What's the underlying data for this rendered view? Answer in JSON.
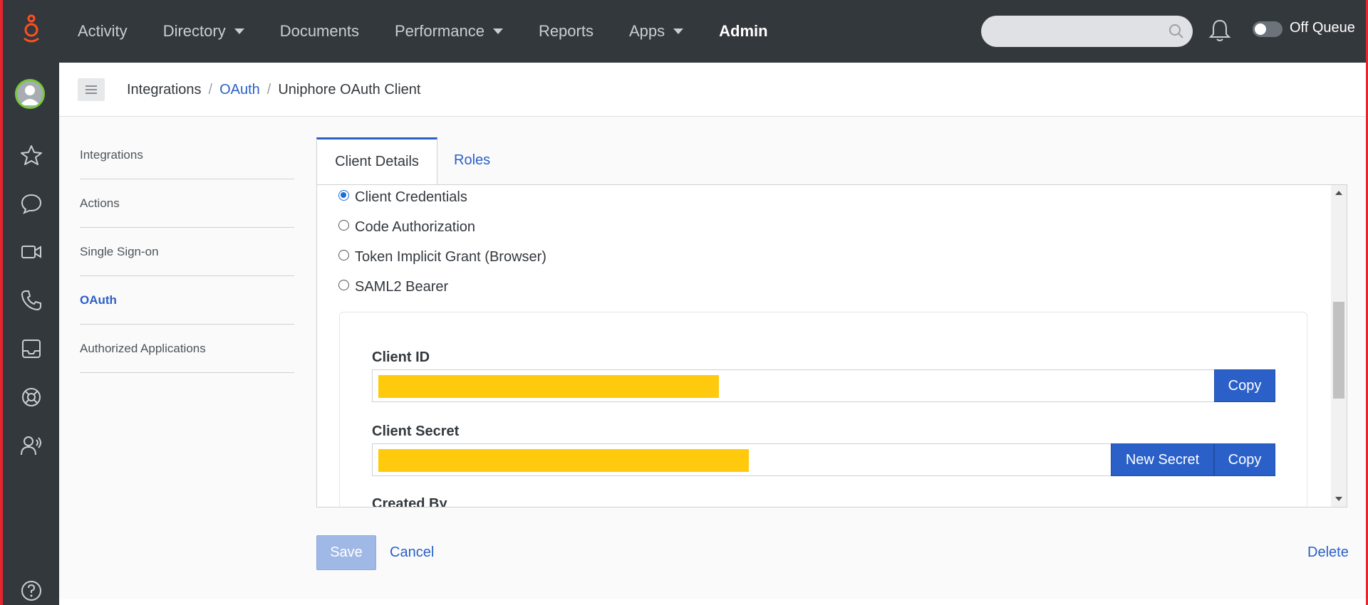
{
  "topnav": {
    "items": [
      {
        "label": "Activity",
        "dropdown": false
      },
      {
        "label": "Directory",
        "dropdown": true
      },
      {
        "label": "Documents",
        "dropdown": false
      },
      {
        "label": "Performance",
        "dropdown": true
      },
      {
        "label": "Reports",
        "dropdown": false
      },
      {
        "label": "Apps",
        "dropdown": true
      }
    ],
    "active_label": "Admin",
    "search_placeholder": "",
    "queue_label": "Off Queue"
  },
  "sidebar_icons": [
    "avatar",
    "star-icon",
    "chat-icon",
    "video-icon",
    "phone-icon",
    "inbox-icon",
    "lifebuoy-icon",
    "contacts-icon",
    "help-icon"
  ],
  "breadcrumb": {
    "root": "Integrations",
    "link": "OAuth",
    "current": "Uniphore OAuth Client"
  },
  "leftnav": {
    "items": [
      "Integrations",
      "Actions",
      "Single Sign-on",
      "OAuth",
      "Authorized Applications"
    ],
    "active": "OAuth"
  },
  "tabs": {
    "active": "Client Details",
    "inactive": "Roles"
  },
  "grant_types": {
    "options": [
      "Client Credentials",
      "Code Authorization",
      "Token Implicit Grant (Browser)",
      "SAML2 Bearer"
    ],
    "selected": "Client Credentials"
  },
  "credentials": {
    "client_id_label": "Client ID",
    "client_secret_label": "Client Secret",
    "copy_label": "Copy",
    "new_secret_label": "New Secret",
    "created_by_label": "Created By"
  },
  "footer": {
    "save_label": "Save",
    "cancel_label": "Cancel",
    "delete_label": "Delete"
  },
  "colors": {
    "accent": "#2a60c8",
    "topbar": "#33383d",
    "brand_orange": "#ff4f1f",
    "redaction": "#ffc90e"
  }
}
